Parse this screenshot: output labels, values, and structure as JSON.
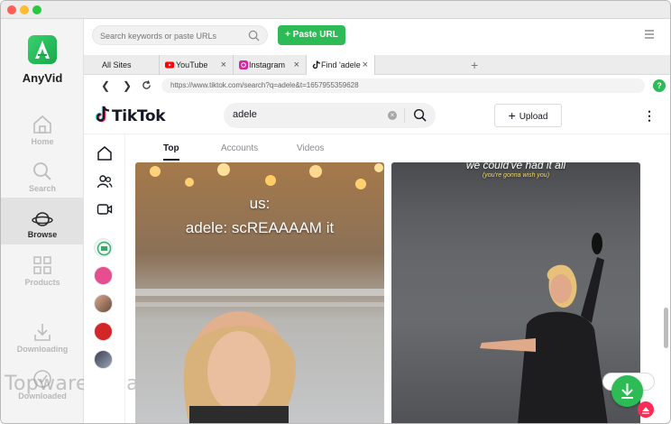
{
  "app": {
    "name": "AnyVid"
  },
  "sidebar": {
    "items": [
      {
        "label": "Home",
        "icon": "home-icon"
      },
      {
        "label": "Search",
        "icon": "search-icon"
      },
      {
        "label": "Browse",
        "icon": "planet-icon",
        "active": true
      },
      {
        "label": "Products",
        "icon": "grid-icon"
      },
      {
        "label": "Downloading",
        "icon": "download-icon"
      },
      {
        "label": "Downloaded",
        "icon": "check-circle-icon"
      }
    ]
  },
  "watermark": "TopwareonSale",
  "topbar": {
    "search_placeholder": "Search keywords or paste URLs",
    "paste_label": "Paste URL"
  },
  "tabs": [
    {
      "label": "All Sites"
    },
    {
      "label": "YouTube"
    },
    {
      "label": "Instagram"
    },
    {
      "label": "Find 'adele"
    }
  ],
  "address": {
    "url": "https://www.tiktok.com/search?q=adele&t=1657955359628"
  },
  "tiktok": {
    "logo": "TikTok",
    "query": "adele",
    "upload_label": "Upload",
    "tabs": [
      "Top",
      "Accounts",
      "Videos"
    ]
  },
  "videos": [
    {
      "caption_line1": "us:",
      "caption_line2": "adele: scREAAAAM it"
    },
    {
      "caption_line1": "we could've had it all",
      "caption_line2": "(you're gonna wish you)"
    }
  ],
  "colors": {
    "accent": "#2dbb55",
    "tiktok_red": "#fe2c55"
  }
}
